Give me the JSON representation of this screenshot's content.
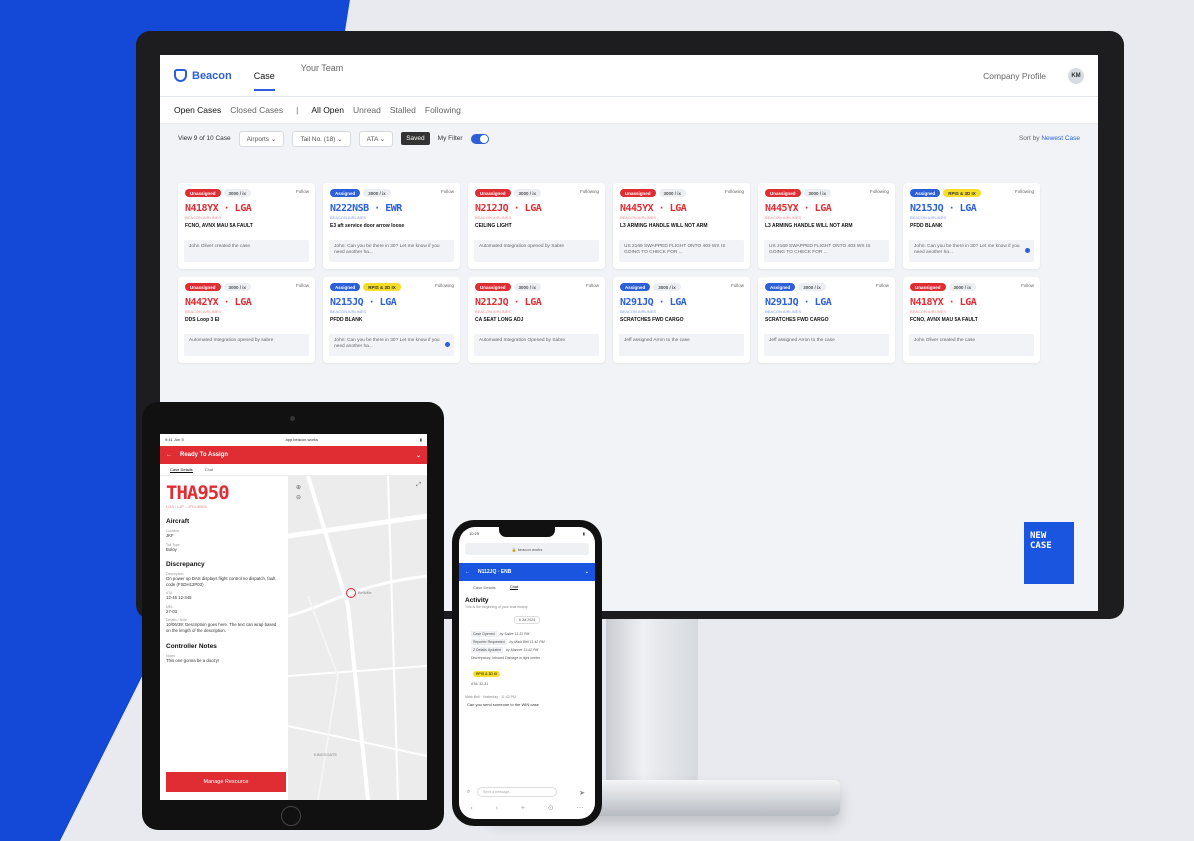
{
  "desktop": {
    "brand": "Beacon",
    "nav": [
      "Case",
      "Your Team"
    ],
    "company_profile": "Company Profile",
    "avatar_initials": "KM",
    "filters": {
      "open": "Open Cases",
      "closed": "Closed Cases",
      "separator": "|",
      "all": "All Open",
      "unread": "Unread",
      "stalled": "Stalled",
      "following": "Following"
    },
    "toolbar": {
      "count": "View 9 of 10 Case",
      "airports": "Airports",
      "tail": "Tail No. (18)",
      "ata": "ATA",
      "saved": "Saved",
      "my_filter": "My Filter",
      "sort_label": "Sort by",
      "sort_value": "Newest Case"
    },
    "cards": [
      {
        "status": "Unassigned",
        "tag": "3000 / ix",
        "follow": "Follow",
        "code": "N418YX · LGA",
        "airline": "BEACON AIRLINES",
        "desc": "FCNO, AVNX MAU 5A FAULT",
        "note": "John Oliver created the case",
        "color": "red",
        "dot": false,
        "yellow": ""
      },
      {
        "status": "Assigned",
        "tag": "3000 / ix",
        "follow": "Follow",
        "code": "N222NSB · EWR",
        "airline": "BEACON AIRLINES",
        "desc": "E3 aft service door arrow loose",
        "note": "John: Can you be there in 30? Let me know if you need another ha...",
        "color": "blue",
        "dot": false,
        "yellow": ""
      },
      {
        "status": "Unassigned",
        "tag": "3000 / ix",
        "follow": "Following",
        "code": "N212JQ · LGA",
        "airline": "BEACON AIRLINES",
        "desc": "CEILING LIGHT",
        "note": "Automated Integration opened by Sabre",
        "color": "red",
        "dot": false,
        "yellow": ""
      },
      {
        "status": "Unassigned",
        "tag": "3000 / ix",
        "follow": "Following",
        "code": "N445YX · LGA",
        "airline": "BEACON AIRLINES",
        "desc": "L3 ARMING HANDLE WILL NOT ARM",
        "note": "US 2169 SWAPPED FLIGHT ONTO 403 WX IS GOING TO CHECK FOR ...",
        "color": "red",
        "dot": false,
        "yellow": ""
      },
      {
        "status": "Unassigned",
        "tag": "3000 / ix",
        "follow": "Following",
        "code": "N445YX · LGA",
        "airline": "BEACON AIRLINES",
        "desc": "L3 ARMING HANDLE WILL NOT ARM",
        "note": "US 2169 SWAPPED FLIGHT ONTO 403 WX IS GOING TO CHECK FOR ...",
        "color": "red",
        "dot": false,
        "yellow": ""
      },
      {
        "status": "Assigned",
        "tag": "",
        "follow": "Following",
        "code": "N215JQ · LGA",
        "airline": "BEACON AIRLINES",
        "desc": "PFDD BLANK",
        "note": "John: Can you be there in 30? Let me know if you need another ha...",
        "color": "blue",
        "dot": true,
        "yellow": "RPIS & 3D IX"
      },
      {
        "status": "Unassigned",
        "tag": "3000 / ix",
        "follow": "Follow",
        "code": "N442YX · LGA",
        "airline": "BEACON AIRLINES",
        "desc": "DDS Loop 3 EI",
        "note": "Automated Integration opened by sabre",
        "color": "red",
        "dot": false,
        "yellow": ""
      },
      {
        "status": "Assigned",
        "tag": "",
        "follow": "Following",
        "code": "N215JQ · LGA",
        "airline": "BEACON AIRLINES",
        "desc": "PFDD BLANK",
        "note": "John: Can you be there in 30? Let me know if you need another ha...",
        "color": "blue",
        "dot": true,
        "yellow": "RPIS & 3D IX"
      },
      {
        "status": "Unassigned",
        "tag": "3000 / ix",
        "follow": "Follow",
        "code": "N212JQ · LGA",
        "airline": "BEACON AIRLINES",
        "desc": "CA SEAT LONG ADJ",
        "note": "Automated Integration Opened by Sabre",
        "color": "red",
        "dot": false,
        "yellow": ""
      },
      {
        "status": "Assigned",
        "tag": "3000 / ix",
        "follow": "Follow",
        "code": "N291JQ · LGA",
        "airline": "BEACON AIRLINES",
        "desc": "SCRATCHES FWD CARGO",
        "note": "Jeff assigned Arron to the case",
        "color": "blue",
        "dot": false,
        "yellow": ""
      },
      {
        "status": "Assigned",
        "tag": "3000 / ix",
        "follow": "Follow",
        "code": "N291JQ · LGA",
        "airline": "BEACON AIRLINES",
        "desc": "SCRATCHES FWD CARGO",
        "note": "Jeff assigned Arron to the case",
        "color": "blue",
        "dot": false,
        "yellow": ""
      },
      {
        "status": "Unassigned",
        "tag": "3000 / ix",
        "follow": "Follow",
        "code": "N418YX · LGA",
        "airline": "BEACON AIRLINES",
        "desc": "FCNO, AVNX MAU 5A FAULT",
        "note": "John Oliver created the case",
        "color": "red",
        "dot": false,
        "yellow": ""
      }
    ],
    "new_case": "NEW CASE"
  },
  "tablet": {
    "time": "9:41 Jun 5",
    "url": "app.beacon.works",
    "header": "Ready To Assign",
    "tabs": [
      "Case Details",
      "Chat"
    ],
    "code": "THA950",
    "route": "LGA / LJP - JFDU8908",
    "aircraft": "Aircraft",
    "location_label": "Location",
    "location": "JKF",
    "tail_label": "Tail Type",
    "tail": "Boloy",
    "discrepancy": "Discrepancy",
    "desc_label": "Description",
    "desc": "On power up DAS displays flight control no dispatch, fault code (FSDH12P03)",
    "ata_label": "ATA",
    "ata": "12-45 12-345",
    "mel_label": "MEL",
    "mel": "27-03",
    "detail_label": "Details / Note",
    "detail": "10/06/39: Description goes here. The text can wrap based on the length of the description.",
    "controller": "Controller Notes",
    "notes_label": "Notes",
    "notes": "This one gonna be a doozy!",
    "button": "Manage Resource",
    "map_labels": [
      "Bellville",
      "KINGSGATE"
    ]
  },
  "phone": {
    "time": "10:25",
    "url": "beacon.works",
    "header": "N112JQ · ENB",
    "tabs": [
      "Case Details",
      "Chat"
    ],
    "activity": "Activity",
    "subtitle": "This is the beginning of your chat history",
    "date": "6 Jul 2024",
    "events": [
      {
        "tag": "Case Opened",
        "text": "by Sabre  11:31 PM"
      },
      {
        "tag": "Reporter Requested",
        "text": "by Mark Bell  11:42 PM"
      },
      {
        "tag": "Z Details Updated",
        "text": "by Manner  11:42 PM"
      }
    ],
    "discrepancy": "Discrepancy: Inboard Damage in light center",
    "yellow": "RPIS & 3D IX",
    "ata": "ATA: 32-31",
    "sender": "Mark Bell · Yesterday · 11:42 PM",
    "message": "Can you send someone to the WIN case",
    "input_placeholder": "Send a message...",
    "nav_icons": [
      "‹",
      "›",
      "+",
      "⊙",
      "⋯"
    ]
  }
}
